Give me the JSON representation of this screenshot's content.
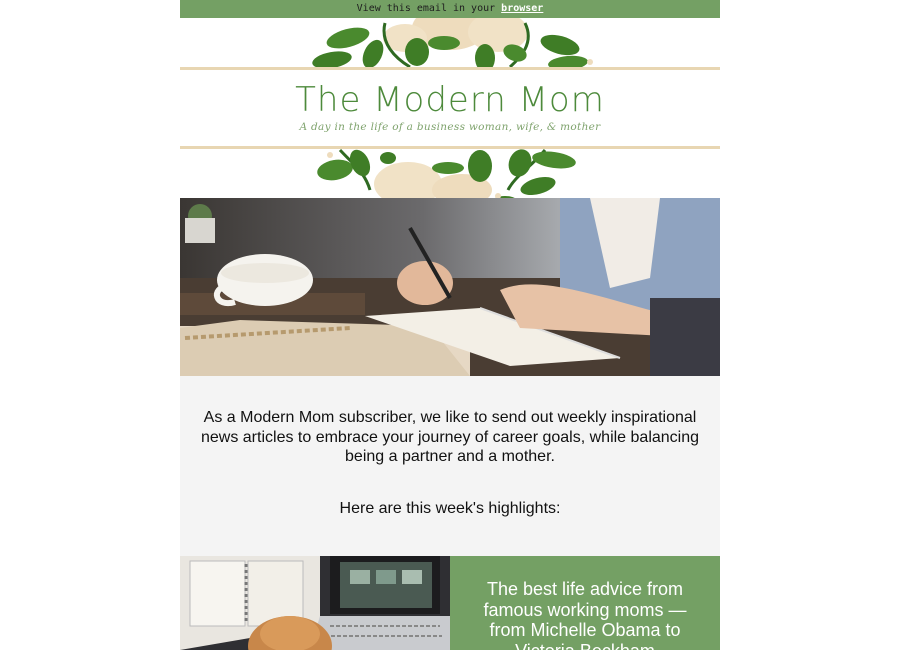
{
  "topbar": {
    "prefix": "View this email in your",
    "link": "browser"
  },
  "brand": {
    "title": "The Modern Mom",
    "tagline": "A day in the life of a business woman, wife, & mother"
  },
  "intro": {
    "lead": "As a Modern Mom subscriber, we like to send out weekly inspirational news articles to embrace your journey of career goals, while balancing being a partner and a mother.",
    "highlights": "Here are this week's highlights:"
  },
  "feature": {
    "headline": "The best life advice from famous working moms — from Michelle Obama to Victoria Beckham"
  },
  "colors": {
    "accent": "#74a064",
    "title": "#4d8a3b",
    "rule": "#e8d6b2",
    "intro_bg": "#f4f4f4"
  }
}
